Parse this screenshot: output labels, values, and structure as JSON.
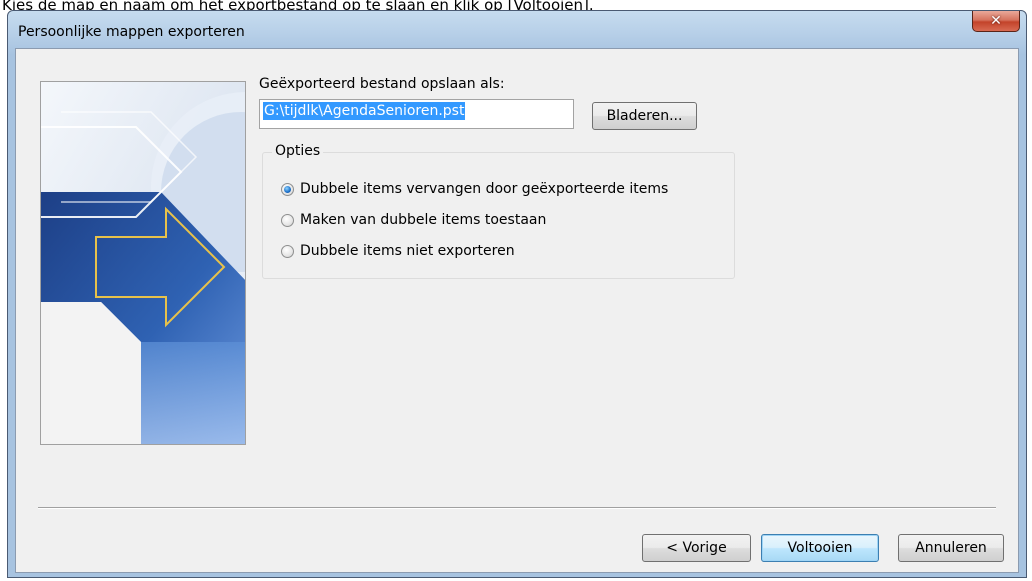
{
  "instruction_caption": "Kies de map en naam om het exportbestand op te slaan en klik op [Voltooien].",
  "window": {
    "title": "Persoonlijke mappen exporteren",
    "close_glyph": "✕"
  },
  "form": {
    "save_as_label": "Geëxporteerd bestand opslaan als:",
    "file_path_value": "G:\\tijdlk\\AgendaSenioren.pst",
    "browse_button": "Bladeren..."
  },
  "options": {
    "title": "Opties",
    "items": [
      {
        "label": "Dubbele items vervangen door geëxporteerde items",
        "selected": true
      },
      {
        "label": "Maken van dubbele items toestaan",
        "selected": false
      },
      {
        "label": "Dubbele items niet exporteren",
        "selected": false
      }
    ]
  },
  "footer": {
    "back_button": "< Vorige",
    "finish_button": "Voltooien",
    "cancel_button": "Annuleren"
  },
  "colors": {
    "title_bar": "#b9d1e9",
    "dialog_background": "#f0f0f0",
    "close_button": "#c3432a",
    "selection": "#3399ff",
    "default_button_border": "#3c7fb1"
  }
}
